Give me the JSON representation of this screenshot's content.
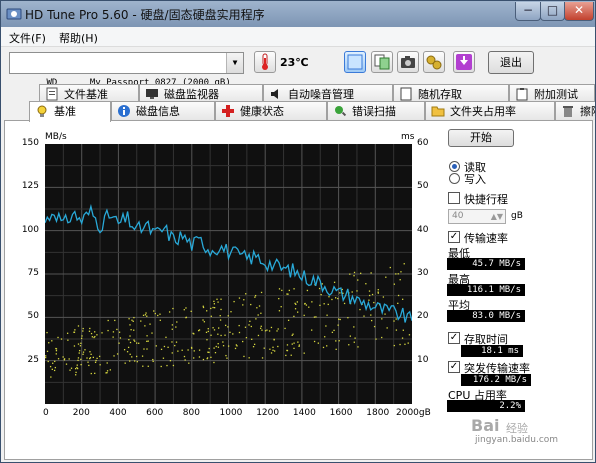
{
  "window": {
    "title": "HD Tune Pro 5.60 - 硬盘/固态硬盘实用程序",
    "controls": {
      "minimize": "−",
      "maximize": "□",
      "close": "✕"
    }
  },
  "menu": {
    "file": "文件(F)",
    "help": "帮助(H)"
  },
  "toolbar": {
    "drive": "WD      My Passport 0827 (2000 gB)",
    "temperature": "23℃",
    "exit_label": "退出",
    "icons": [
      "thermometer-icon",
      "highlight-icon",
      "copy-icon",
      "camera-icon",
      "tools-icon",
      "download-icon"
    ]
  },
  "tabs_top": [
    "文件基准",
    "磁盘监视器",
    "自动噪音管理",
    "随机存取",
    "附加测试"
  ],
  "tabs_bottom": [
    "基准",
    "磁盘信息",
    "健康状态",
    "错误扫描",
    "文件夹占用率",
    "擦除"
  ],
  "chart": {
    "left_unit": "MB/s",
    "right_unit": "ms",
    "left_ticks": [
      "150",
      "125",
      "100",
      "75",
      "50",
      "25"
    ],
    "right_ticks": [
      "60",
      "50",
      "40",
      "30",
      "20",
      "10"
    ],
    "x_ticks": [
      "0",
      "200",
      "400",
      "600",
      "800",
      "1000",
      "1200",
      "1400",
      "1600",
      "1800",
      "2000gB"
    ]
  },
  "chart_data": {
    "type": "line",
    "x_label": "gB",
    "y_left_label": "MB/s",
    "y_right_label": "ms",
    "xlim": [
      0,
      2000
    ],
    "ylim_left": [
      0,
      150
    ],
    "ylim_right": [
      0,
      60
    ],
    "series": [
      {
        "name": "传输速率",
        "color": "#29a9d8",
        "axis": "left",
        "x": [
          0,
          50,
          100,
          150,
          200,
          250,
          300,
          350,
          400,
          450,
          500,
          550,
          600,
          650,
          700,
          750,
          800,
          850,
          900,
          950,
          1000,
          1050,
          1100,
          1150,
          1200,
          1250,
          1300,
          1350,
          1400,
          1450,
          1500,
          1550,
          1600,
          1650,
          1700,
          1750,
          1800,
          1850,
          1900,
          1950,
          2000
        ],
        "y": [
          105,
          112,
          103,
          110,
          106,
          111,
          103,
          109,
          104,
          107,
          100,
          103,
          98,
          101,
          95,
          97,
          92,
          94,
          89,
          91,
          88,
          86,
          84,
          85,
          82,
          80,
          78,
          77,
          74,
          72,
          70,
          67,
          64,
          63,
          60,
          58,
          56,
          54,
          53,
          51,
          48
        ]
      },
      {
        "name": "存取时间",
        "color": "#d8d840",
        "axis": "right",
        "kind": "scatter",
        "range_ms": [
          6,
          30
        ]
      }
    ]
  },
  "controls": {
    "start_label": "开始",
    "read_label": "读取",
    "write_label": "写入",
    "short_stroke_label": "快捷行程",
    "short_stroke_value": "40",
    "short_stroke_unit": "gB",
    "transfer_rate_label": "传输速率",
    "min_label": "最低",
    "min_value": "45.7 MB/s",
    "max_label": "最高",
    "max_value": "116.1 MB/s",
    "avg_label": "平均",
    "avg_value": "83.0 MB/s",
    "access_time_label": "存取时间",
    "access_time_value": "18.1 ms",
    "burst_rate_label": "突发传输速率",
    "burst_rate_value": "176.2 MB/s",
    "cpu_label": "CPU 占用率",
    "cpu_value": "2.2%"
  },
  "watermark": {
    "line1": "Bai",
    "line2": "经验",
    "line3": "jingyan.baidu.com"
  },
  "colors": {
    "line": "#29a9d8",
    "dots": "#d8d840",
    "chart_bg": "#101010",
    "grid": "#555555"
  }
}
